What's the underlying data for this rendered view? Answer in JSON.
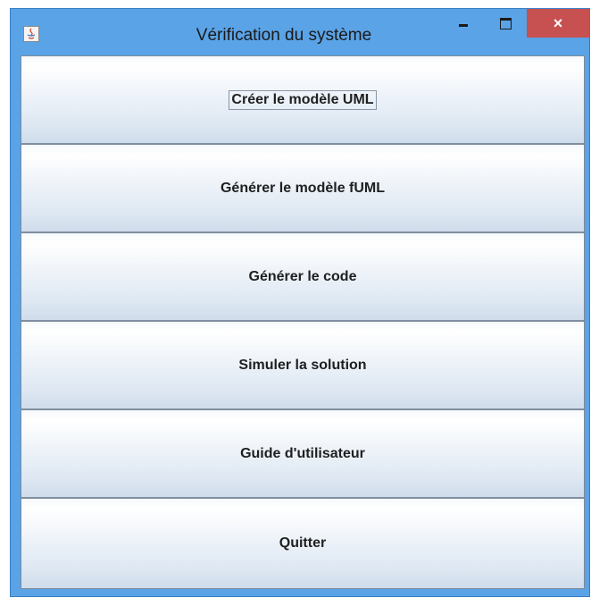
{
  "window": {
    "title": "Vérification du système",
    "close_glyph": "×"
  },
  "buttons": [
    {
      "label": "Créer le modèle UML",
      "focused": true
    },
    {
      "label": "Générer le modèle fUML",
      "focused": false
    },
    {
      "label": "Générer le code",
      "focused": false
    },
    {
      "label": "Simuler la solution",
      "focused": false
    },
    {
      "label": "Guide d'utilisateur",
      "focused": false
    },
    {
      "label": "Quitter",
      "focused": false
    }
  ],
  "colors": {
    "titlebar": "#5aa3e6",
    "close_button": "#c75050",
    "button_gradient_top": "#ffffff",
    "button_gradient_bottom": "#cfdceb"
  },
  "icons": {
    "app_icon": "java-app-icon",
    "minimize": "minimize-icon",
    "maximize": "maximize-icon",
    "close": "close-icon"
  }
}
